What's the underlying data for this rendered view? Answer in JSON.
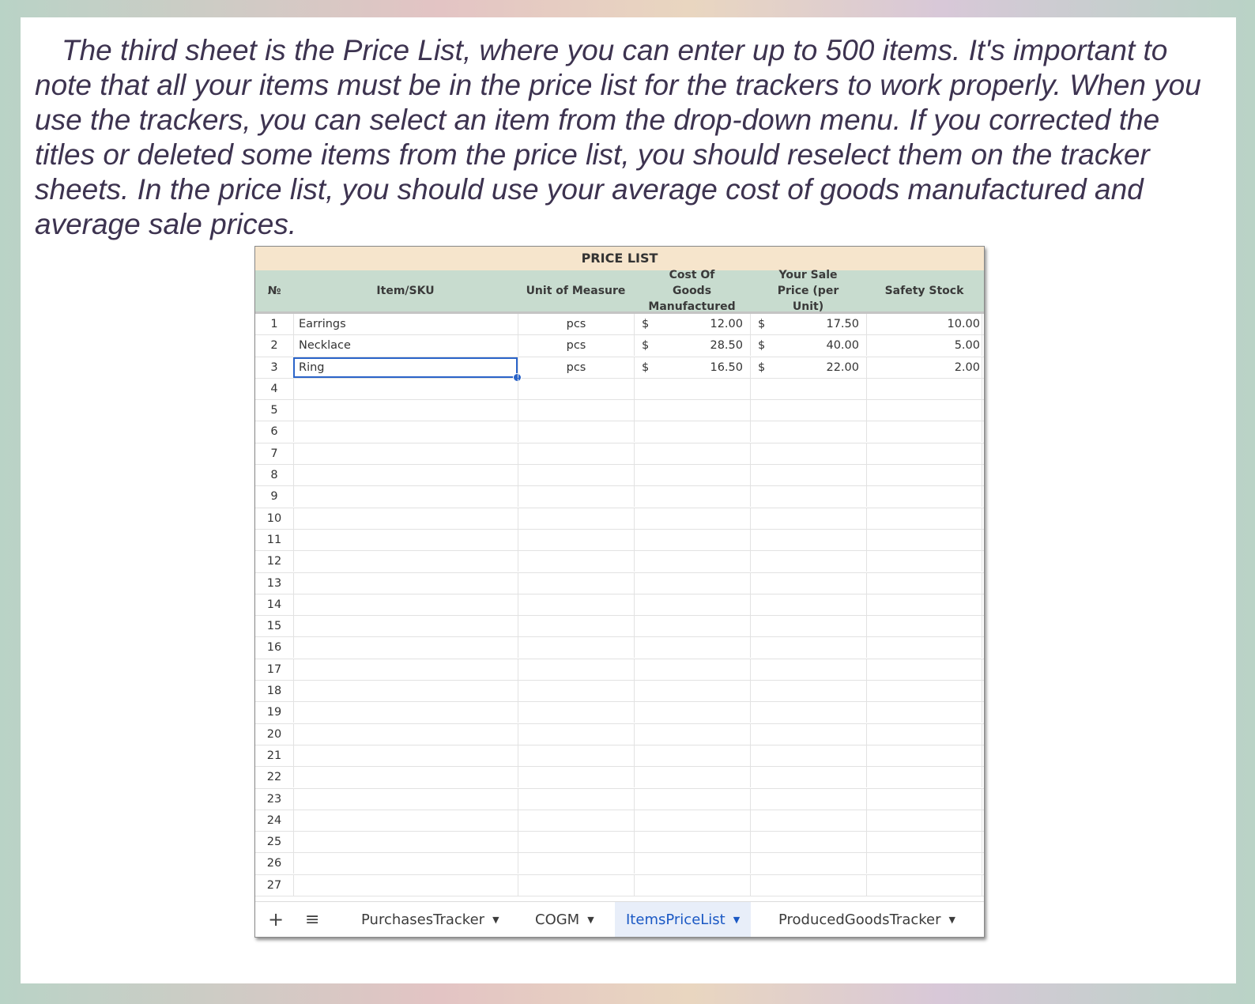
{
  "intro_text": "The third sheet is the Price List, where you can enter up to 500 items. It's important to note that all your items must be in the price list for the trackers to work properly. When you use the trackers, you can select an item from the drop-down menu. If you corrected the titles or deleted some items from the price list, you should reselect them on the tracker sheets. In the price list, you should use your average cost of goods manufactured and average sale prices.",
  "sheet": {
    "title": "PRICE LIST",
    "headers": {
      "num": "№",
      "item": "Item/SKU",
      "uom": "Unit of Measure",
      "cost": "Cost Of Goods Manufactured",
      "sale": "Your Sale Price (per Unit)",
      "safety": "Safety Stock"
    },
    "currency_symbol": "$",
    "rows": [
      {
        "num": "1",
        "item": "Earrings",
        "uom": "pcs",
        "cost": "12.00",
        "sale": "17.50",
        "safety": "10.00"
      },
      {
        "num": "2",
        "item": "Necklace",
        "uom": "pcs",
        "cost": "28.50",
        "sale": "40.00",
        "safety": "5.00"
      },
      {
        "num": "3",
        "item": "Ring",
        "uom": "pcs",
        "cost": "16.50",
        "sale": "22.00",
        "safety": "2.00"
      },
      {
        "num": "4"
      },
      {
        "num": "5"
      },
      {
        "num": "6"
      },
      {
        "num": "7"
      },
      {
        "num": "8"
      },
      {
        "num": "9"
      },
      {
        "num": "10"
      },
      {
        "num": "11"
      },
      {
        "num": "12"
      },
      {
        "num": "13"
      },
      {
        "num": "14"
      },
      {
        "num": "15"
      },
      {
        "num": "16"
      },
      {
        "num": "17"
      },
      {
        "num": "18"
      },
      {
        "num": "19"
      },
      {
        "num": "20"
      },
      {
        "num": "21"
      },
      {
        "num": "22"
      },
      {
        "num": "23"
      },
      {
        "num": "24"
      },
      {
        "num": "25"
      },
      {
        "num": "26"
      },
      {
        "num": "27"
      }
    ],
    "selected_row": 2
  },
  "tabs": {
    "add_icon": "+",
    "menu_icon": "≡",
    "items": [
      {
        "label": "PurchasesTracker",
        "active": false
      },
      {
        "label": "COGM",
        "active": false
      },
      {
        "label": "ItemsPriceList",
        "active": true
      },
      {
        "label": "ProducedGoodsTracker",
        "active": false
      }
    ],
    "caret_icon": "▼"
  },
  "colors": {
    "title_bg": "#f6e5cc",
    "header_bg": "#c8dccf",
    "active_tab_text": "#1a58c4",
    "selection": "#2b64c9",
    "intro_text": "#3d3350"
  }
}
